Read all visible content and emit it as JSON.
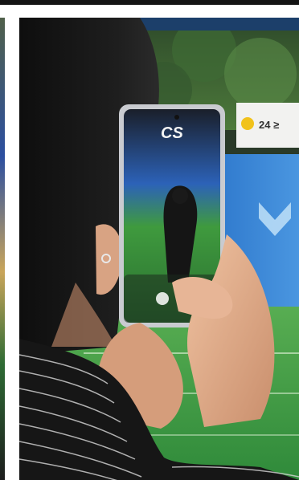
{
  "scene": {
    "description_tags": [
      "person",
      "smartphone",
      "sports-field",
      "stadium-screen"
    ],
    "phone_screen_text": "CS",
    "background_sign_text": "24 ≥",
    "colors": {
      "field_green": "#3f9a3e",
      "banner_blue": "#2b73c6",
      "hair": "#151515",
      "phone_frame": "#c9cbd0",
      "sweater_black": "#161616",
      "skin": "#e3b391"
    }
  }
}
